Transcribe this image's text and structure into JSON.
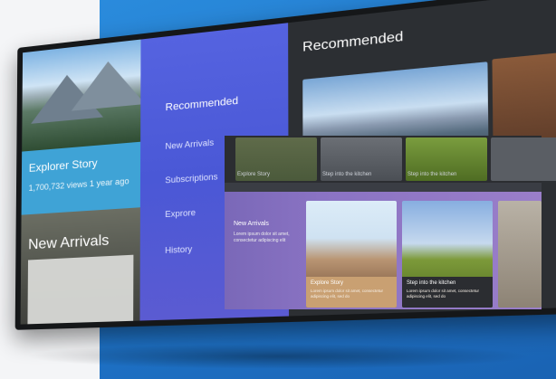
{
  "hero": {
    "title": "Explorer Story",
    "meta": "1,700,732 views  1 year ago",
    "section": "New Arrivals"
  },
  "drawer": {
    "items": [
      {
        "label": "Recommended",
        "active": true
      },
      {
        "label": "New Arrivals",
        "active": false
      },
      {
        "label": "Subscriptions",
        "active": false
      },
      {
        "label": "Exprore",
        "active": false
      },
      {
        "label": "History",
        "active": false
      }
    ]
  },
  "content": {
    "title": "Recommended"
  },
  "overlay": {
    "row_captions": [
      "Explore Story",
      "Step into the kitchen",
      "Step into the kitchen"
    ],
    "band": {
      "title": "New Arrivals",
      "description": "Lorem ipsum dolor sit amet, consectetur adipiscing elit"
    },
    "cards": [
      {
        "title": "Explore Story",
        "description": "Lorem ipsum dolor sit amet, consectetur adipiscing elit, sed do"
      },
      {
        "title": "Step into the kitchen",
        "description": "Lorem ipsum dolor sit amet, consectetur adipiscing elit, sed do"
      }
    ]
  }
}
